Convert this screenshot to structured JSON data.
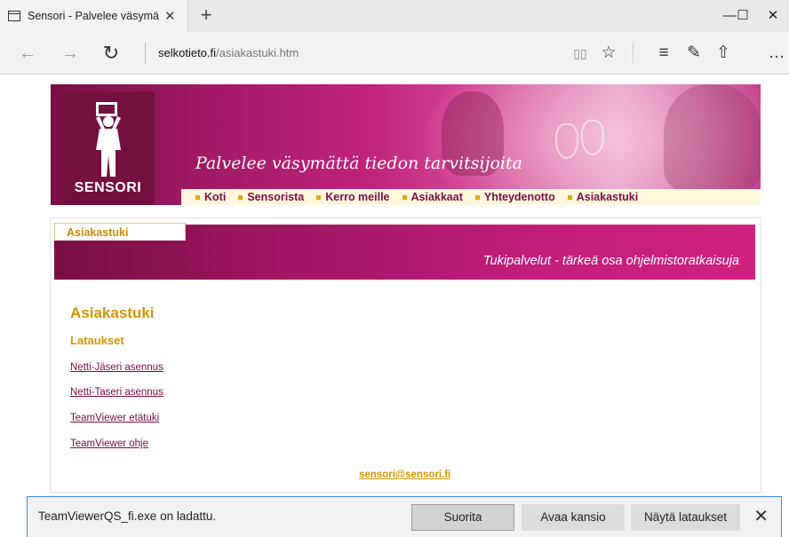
{
  "browser": {
    "tab_title": "Sensori - Palvelee väsymä",
    "tab_close": "✕",
    "new_tab": "+",
    "url_domain": "selkotieto.fi",
    "url_path": "/asiakastuki.htm",
    "window_controls": {
      "minimize": "—",
      "maximize": "☐",
      "close": "✕"
    },
    "icons": {
      "back": "←",
      "forward": "→",
      "refresh": "↻",
      "reading_view": "▯▯",
      "favorite": "☆",
      "hub": "≡",
      "notes": "✎",
      "share": "⇧",
      "more": "…"
    }
  },
  "site": {
    "logo_text": "SENSORI",
    "slogan": "Palvelee väsymättä tiedon tarvitsijoita",
    "nav": [
      {
        "label": "Koti"
      },
      {
        "label": "Sensorista"
      },
      {
        "label": "Kerro meille"
      },
      {
        "label": "Asiakkaat"
      },
      {
        "label": "Yhteydenotto"
      },
      {
        "label": "Asiakastuki"
      }
    ],
    "section_tab": "Asiakastuki",
    "section_tagline": "Tukipalvelut - tärkeä osa ohjelmistoratkaisuja",
    "heading": "Asiakastuki",
    "subheading": "Lataukset",
    "links": [
      {
        "label": "Netti-Jäseri asennus"
      },
      {
        "label": "Netti-Taseri asennus"
      },
      {
        "label": "TeamViewer etätuki"
      },
      {
        "label": "TeamViewer ohje"
      }
    ],
    "email": "sensori@sensori.fi",
    "colors": {
      "brand_magenta": "#a01a64",
      "accent_gold": "#d49400",
      "nav_bg": "#fff8dc"
    }
  },
  "download_bar": {
    "message": "TeamViewerQS_fi.exe on ladattu.",
    "run": "Suorita",
    "open_folder": "Avaa kansio",
    "view_downloads": "Näytä lataukset",
    "close": "✕"
  }
}
